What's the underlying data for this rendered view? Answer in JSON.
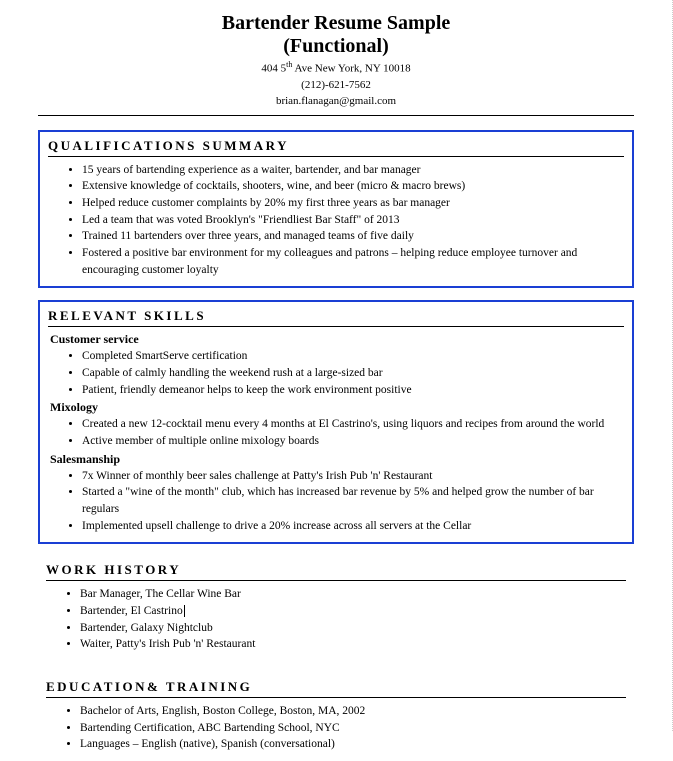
{
  "header": {
    "title_line1": "Bartender Resume Sample",
    "title_line2": "(Functional)",
    "address_pre": "404 5",
    "address_sup": "th",
    "address_post": " Ave New York, NY 10018",
    "phone": "(212)-621-7562",
    "email": "brian.flanagan@gmail.com"
  },
  "qualifications": {
    "heading": "QUALIFICATIONS SUMMARY",
    "items": [
      "15 years of bartending experience as a waiter, bartender, and bar manager",
      "Extensive knowledge of cocktails, shooters, wine, and beer (micro & macro brews)",
      "Helped reduce customer complaints by 20% my first three years as bar manager",
      "Led a team that was voted Brooklyn's \"Friendliest Bar Staff\" of 2013",
      "Trained 11 bartenders over three years, and managed teams of five daily",
      "Fostered a positive bar environment for my colleagues and patrons – helping reduce employee turnover and encouraging customer loyalty"
    ]
  },
  "skills": {
    "heading": "RELEVANT SKILLS",
    "groups": [
      {
        "label": "Customer service",
        "items": [
          "Completed SmartServe certification",
          "Capable of calmly handling the weekend rush at a large-sized bar",
          "Patient, friendly demeanor helps to keep the work environment positive"
        ]
      },
      {
        "label": "Mixology",
        "items": [
          "Created a new 12-cocktail menu every 4 months at El Castrino's, using liquors and recipes from around the world",
          "Active member of multiple online mixology boards"
        ]
      },
      {
        "label": "Salesmanship",
        "items": [
          "7x Winner of monthly beer sales challenge at Patty's Irish Pub 'n' Restaurant",
          "Started a \"wine of the month\" club, which has increased bar revenue by 5% and helped grow the number of bar regulars",
          "Implemented upsell challenge to drive a 20% increase across all servers at the Cellar"
        ]
      }
    ]
  },
  "work": {
    "heading": "WORK HISTORY",
    "items": [
      "Bar Manager, The Cellar Wine Bar",
      "Bartender, El Castrino",
      "Bartender, Galaxy Nightclub",
      "Waiter, Patty's Irish Pub 'n' Restaurant"
    ]
  },
  "education": {
    "heading": "EDUCATION& TRAINING",
    "items": [
      "Bachelor of Arts, English, Boston College, Boston, MA, 2002",
      "Bartending Certification, ABC Bartending School, NYC",
      "Languages – English (native), Spanish (conversational)"
    ]
  }
}
